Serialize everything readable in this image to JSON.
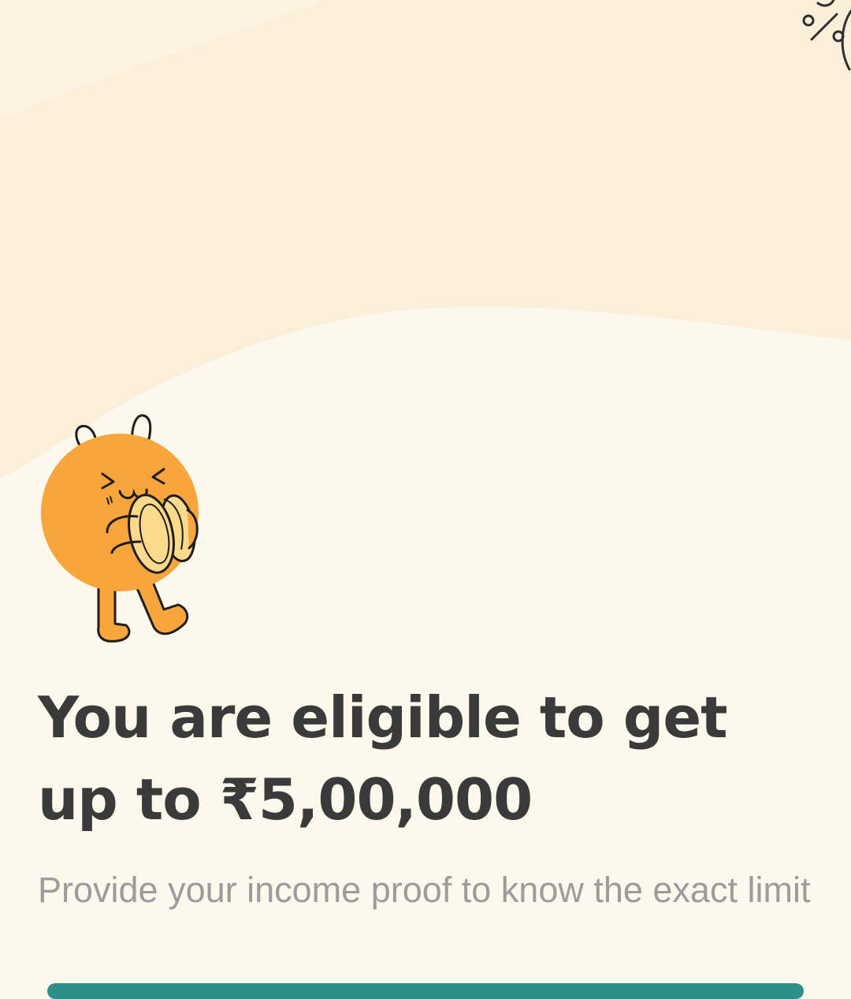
{
  "eligibility": {
    "headline_line1": "You are eligible to get",
    "headline_line2": "up to ₹5,00,000",
    "subtext": "Provide your income proof to know the exact limit"
  },
  "illustration": {
    "name": "mascot-hugging-coins",
    "body_color": "#F7A53C",
    "coin_color": "#FCDA8B"
  },
  "colors": {
    "background": "#FDF8EC",
    "wave": "#FBEFD9",
    "headline": "#3A3A3A",
    "subtext": "#9C9C9C",
    "button": "#2E8F88"
  }
}
